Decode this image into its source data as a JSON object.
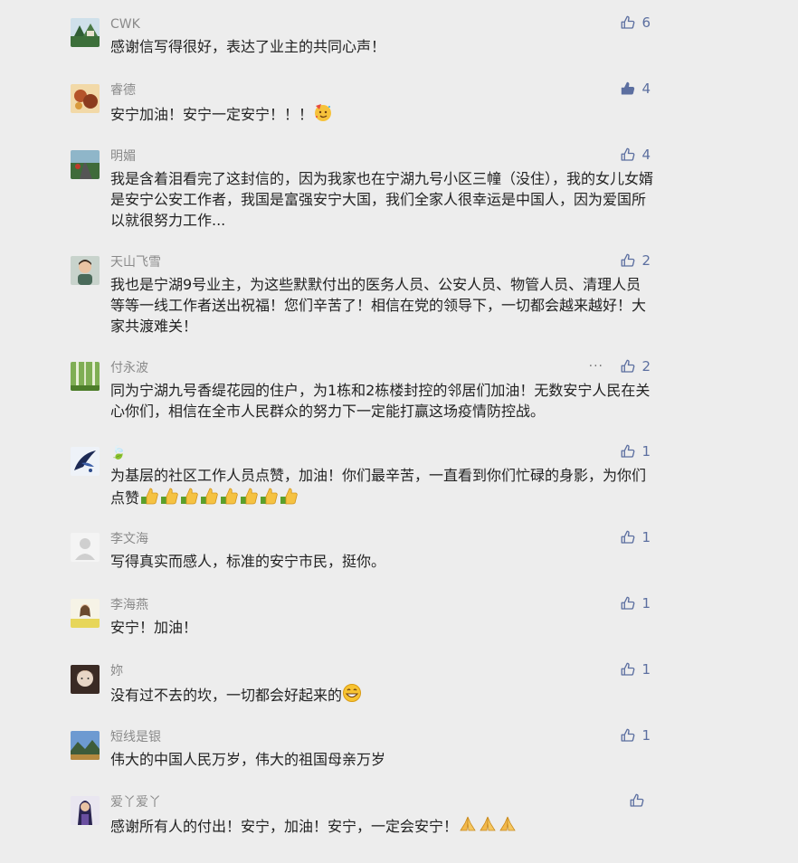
{
  "colors": {
    "background": "#ededed",
    "name": "#8a8a8a",
    "text": "#222222",
    "like_icon": "#5c6fa0"
  },
  "icons": {
    "like": "thumbs-up-icon",
    "liked": "thumbs-up-filled-icon",
    "more": "more-dots-icon"
  },
  "comments": [
    {
      "name": "CWK",
      "text": "感谢信写得很好，表达了业主的共同心声！",
      "likes": "6",
      "avatar": "avatar-landscape",
      "liked": false
    },
    {
      "name": "睿德",
      "text": "安宁加油！安宁一定安宁！！！",
      "emoji": "party-face-emoji",
      "likes": "4",
      "avatar": "avatar-food",
      "liked": true
    },
    {
      "name": "明媚",
      "text": "我是含着泪看完了这封信的，因为我家也在宁湖九号小区三幢（没住），我的女儿女婿是安宁公安工作者，我国是富强安宁大国，我们全家人很幸运是中国人，因为爱国所以就很努力工作...",
      "likes": "4",
      "avatar": "avatar-road",
      "liked": false
    },
    {
      "name": "天山飞雪",
      "text": "我也是宁湖9号业主，为这些默默付出的医务人员、公安人员、物管人员、清理人员等等一线工作者送出祝福！您们辛苦了！相信在党的领导下，一切都会越来越好！大家共渡难关！",
      "likes": "2",
      "avatar": "avatar-child",
      "liked": false
    },
    {
      "name": "付永波",
      "text": "同为宁湖九号香缇花园的住户，为1栋和2栋楼封控的邻居们加油！无数安宁人民在关心你们，相信在全市人民群众的努力下一定能打赢这场疫情防控战。",
      "likes": "2",
      "more": "···",
      "avatar": "avatar-forest",
      "liked": false
    },
    {
      "name": "🍃",
      "text": "为基层的社区工作人员点赞，加油！你们最辛苦，一直看到你们忙碌的身影，为你们点赞",
      "emoji_count": 8,
      "likes": "1",
      "avatar": "avatar-bird",
      "liked": false
    },
    {
      "name": "李文海",
      "text": "写得真实而感人，标准的安宁市民，挺你。",
      "likes": "1",
      "avatar": "avatar-default",
      "liked": false
    },
    {
      "name": "李海燕",
      "text": "安宁！加油！",
      "likes": "1",
      "avatar": "avatar-flowers",
      "liked": false
    },
    {
      "name": "妳",
      "text": "没有过不去的坎，一切都会好起来的",
      "emoji": "grin-emoji",
      "likes": "1",
      "avatar": "avatar-portrait",
      "liked": false
    },
    {
      "name": "短线是银",
      "text": "伟大的中国人民万岁，伟大的祖国母亲万岁",
      "likes": "1",
      "avatar": "avatar-mountains",
      "liked": false
    },
    {
      "name": "爱丫爱丫",
      "text": "感谢所有人的付出！安宁，加油！安宁，一定会安宁！",
      "emoji": "pray-emoji",
      "emoji_count": 3,
      "likes": "",
      "avatar": "avatar-girl",
      "liked": false
    }
  ]
}
